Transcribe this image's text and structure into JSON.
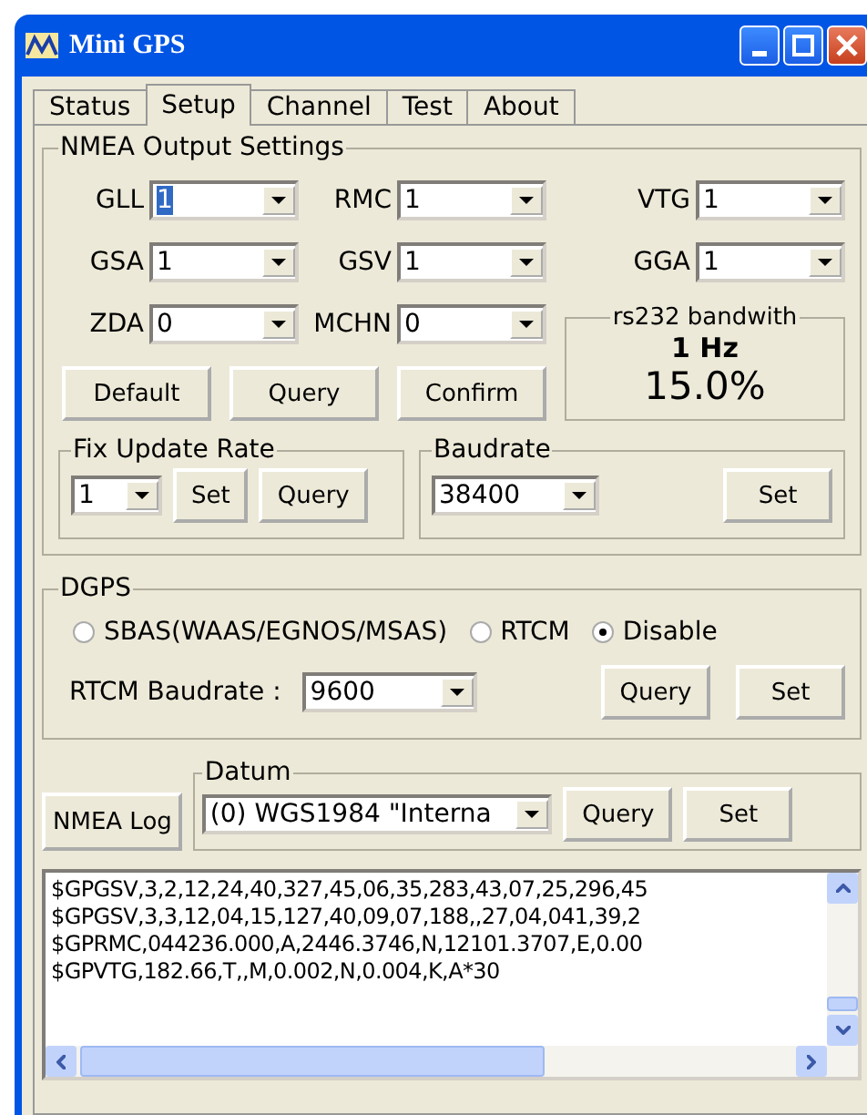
{
  "window": {
    "title": "Mini GPS"
  },
  "tabs": [
    {
      "label": "Status",
      "selected": false
    },
    {
      "label": "Setup",
      "selected": true
    },
    {
      "label": "Channel",
      "selected": false
    },
    {
      "label": "Test",
      "selected": false
    },
    {
      "label": "About",
      "selected": false
    }
  ],
  "nmea_output": {
    "title": "NMEA Output Settings",
    "fields": [
      {
        "label": "GLL",
        "value": "1",
        "highlighted": true
      },
      {
        "label": "RMC",
        "value": "1",
        "highlighted": false
      },
      {
        "label": "VTG",
        "value": "1",
        "highlighted": false
      },
      {
        "label": "GSA",
        "value": "1",
        "highlighted": false
      },
      {
        "label": "GSV",
        "value": "1",
        "highlighted": false
      },
      {
        "label": "GGA",
        "value": "1",
        "highlighted": false
      },
      {
        "label": "ZDA",
        "value": "0",
        "highlighted": false
      },
      {
        "label": "MCHN",
        "value": "0",
        "highlighted": false
      }
    ],
    "buttons": [
      "Default",
      "Query",
      "Confirm"
    ],
    "bandwidth": {
      "title": "rs232 bandwith",
      "rate": "1  Hz",
      "percent": "15.0%"
    },
    "fix_update_rate": {
      "title": "Fix Update Rate",
      "value": "1",
      "buttons": [
        "Set",
        "Query"
      ]
    },
    "baudrate": {
      "title": "Baudrate",
      "value": "38400",
      "button": "Set"
    }
  },
  "dgps": {
    "title": "DGPS",
    "options": [
      {
        "label": "SBAS(WAAS/EGNOS/MSAS)",
        "selected": false
      },
      {
        "label": "RTCM",
        "selected": false
      },
      {
        "label": "Disable",
        "selected": true
      }
    ],
    "rtcm_baudrate": {
      "label": "RTCM Baudrate :",
      "value": "9600"
    },
    "buttons": [
      "Query",
      "Set"
    ]
  },
  "nmea_log_button": "NMEA Log",
  "datum": {
    "title": "Datum",
    "value": "(0) WGS1984 \"Interna",
    "buttons": [
      "Query",
      "Set"
    ]
  },
  "log": {
    "lines": [
      "$GPGSV,3,2,12,24,40,327,45,06,35,283,43,07,25,296,45",
      "$GPGSV,3,3,12,04,15,127,40,09,07,188,,27,04,041,39,2",
      "$GPRMC,044236.000,A,2446.3746,N,12101.3707,E,0.00",
      "$GPVTG,182.66,T,,M,0.002,N,0.004,K,A*30"
    ]
  }
}
